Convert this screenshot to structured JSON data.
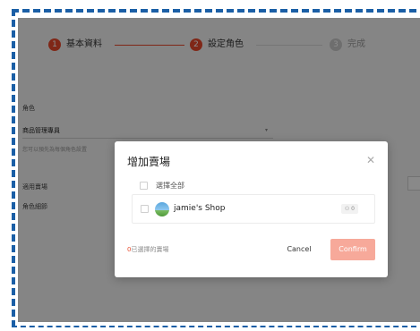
{
  "stepper": {
    "steps": [
      {
        "number": "1",
        "label": "基本資料"
      },
      {
        "number": "2",
        "label": "設定角色"
      },
      {
        "number": "3",
        "label": "完成"
      }
    ]
  },
  "form": {
    "role_label": "角色",
    "role_value": "商品管理專員",
    "role_hint": "您可以預先為每個角色設置",
    "store_label": "適用賣場",
    "permissions_label": "角色細節"
  },
  "modal": {
    "title": "增加賣場",
    "close_icon": "close-icon",
    "select_all_label": "選擇全部",
    "shops": [
      {
        "name": "jamie's Shop",
        "badge": "⚇ 0"
      }
    ],
    "selected_count": "0",
    "selected_suffix": "已選擇的賣場",
    "cancel_label": "Cancel",
    "confirm_label": "Confirm"
  },
  "colors": {
    "accent": "#e8482b",
    "confirm_disabled": "#f7a99a",
    "frame_border": "#1b5fa6"
  }
}
